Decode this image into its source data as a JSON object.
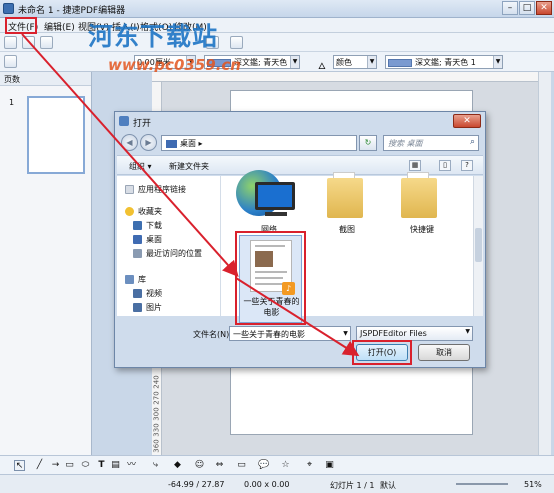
{
  "app": {
    "title": "未命名 1 - 捷速PDF编辑器",
    "menu": [
      "文件(F)",
      "编辑(E)",
      "视图(V)",
      "插入(I)",
      "格式(O)",
      "修改(M)"
    ],
    "watermark": "河东下载站",
    "watermark_url": "www.pc0359.cn"
  },
  "toolbar2": {
    "line_width": "0.00厘米",
    "fill_style": "深文鑑; 青天色 2",
    "color_label": "颜色",
    "swatch_name": "深文鑑; 青天色 1"
  },
  "slides_pane": {
    "header": "页数",
    "slide_number": "1"
  },
  "ruler": {
    "v_marks": [
      "240",
      "270",
      "300",
      "330",
      "360"
    ]
  },
  "statusbar": {
    "position": "-64.99 / 27.87",
    "size": "0.00 x 0.00",
    "slide": "幻灯片 1 / 1",
    "layout": "默认",
    "zoom": "51%"
  },
  "dialog": {
    "title": "打开",
    "address": "桌面",
    "address_sep": "▸",
    "search_placeholder": "搜索 桌面",
    "organize": "组织 ▾",
    "new_folder": "新建文件夹",
    "nav": [
      {
        "label": "应用程序链接",
        "color": "#d8dde5"
      },
      {
        "label": "收藏夹",
        "color": "#f2c131"
      },
      {
        "label": "下载",
        "color": "#3d6fb0"
      },
      {
        "label": "桌面",
        "color": "#3f6bb2"
      },
      {
        "label": "最近访问的位置",
        "color": "#8a9bb2"
      },
      {
        "label": "库",
        "color": "#6c8fbf"
      },
      {
        "label": "视频",
        "color": "#4a6fa3"
      },
      {
        "label": "图片",
        "color": "#4a6fa3"
      }
    ],
    "files": [
      {
        "label": "网络"
      },
      {
        "label": "截图"
      },
      {
        "label": "快捷键"
      }
    ],
    "selected_file": "一些关于青春的电影",
    "filename_label": "文件名(N):",
    "filename_value": "一些关于青春的电影",
    "filter_value": "JSPDFEditor Files",
    "open_button": "打开(O)",
    "cancel_button": "取消"
  },
  "colors": {
    "highlight": "#d9212d",
    "watermark": "#1d74c4",
    "watermark_url": "#e3551e"
  }
}
